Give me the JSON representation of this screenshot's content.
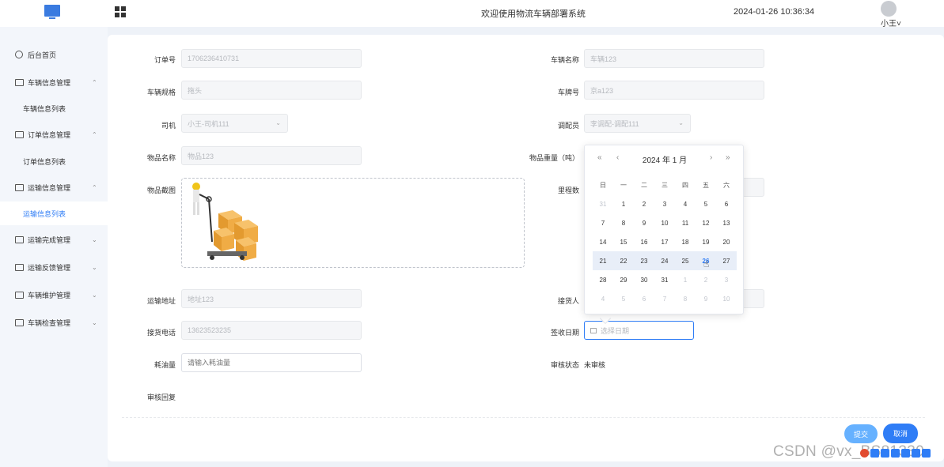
{
  "topbar": {
    "welcome": "欢迎使用物流车辆部署系统",
    "datetime": "2024-01-26 10:36:34",
    "user": "小王"
  },
  "sidebar": {
    "items": [
      {
        "label": "后台首页",
        "icon": "clock-icon"
      },
      {
        "label": "车辆信息管理",
        "icon": "list-icon",
        "caret": "⌃"
      },
      {
        "label": "车辆信息列表",
        "sub": true
      },
      {
        "label": "订单信息管理",
        "icon": "list-icon",
        "caret": "⌃"
      },
      {
        "label": "订单信息列表",
        "sub": true
      },
      {
        "label": "运输信息管理",
        "icon": "list-icon",
        "caret": "⌃"
      },
      {
        "label": "运输信息列表",
        "sub": true,
        "active": true
      },
      {
        "label": "运输完成管理",
        "icon": "list-icon",
        "caret": "⌄"
      },
      {
        "label": "运输反馈管理",
        "icon": "list-icon",
        "caret": "⌄"
      },
      {
        "label": "车辆维护管理",
        "icon": "list-icon",
        "caret": "⌄"
      },
      {
        "label": "车辆检查管理",
        "icon": "list-icon",
        "caret": "⌄"
      }
    ]
  },
  "form": {
    "order_no": {
      "label": "订单号",
      "value": "1706236410731"
    },
    "vehicle_name": {
      "label": "车辆名称",
      "value": "车辆123"
    },
    "vehicle_spec": {
      "label": "车辆规格",
      "value": "拖头"
    },
    "plate_no": {
      "label": "车牌号",
      "value": "京a123"
    },
    "driver": {
      "label": "司机",
      "value": "小王-司机111"
    },
    "dispatcher": {
      "label": "调配员",
      "value": "李调配-调配111"
    },
    "goods_name": {
      "label": "物品名称",
      "value": "物品123"
    },
    "goods_weight": {
      "label": "物品重量（吨）"
    },
    "goods_image": {
      "label": "物品截图"
    },
    "mileage": {
      "label": "里程数"
    },
    "address": {
      "label": "运输地址",
      "value": "地址123"
    },
    "receiver": {
      "label": "接货人"
    },
    "receiver_phone": {
      "label": "接货电话",
      "value": "13623523235"
    },
    "sign_date": {
      "label": "签收日期",
      "placeholder": "选择日期"
    },
    "fuel": {
      "label": "耗油量",
      "placeholder": "请输入耗油量"
    },
    "audit_status": {
      "label": "审核状态",
      "value": "未审核"
    },
    "audit_reply": {
      "label": "审核回复"
    }
  },
  "buttons": {
    "submit": "提交",
    "cancel": "取消"
  },
  "datepicker": {
    "prev_year": "«",
    "prev_month": "‹",
    "next_month": "›",
    "next_year": "»",
    "title": "2024 年  1 月",
    "weekdays": [
      "日",
      "一",
      "二",
      "三",
      "四",
      "五",
      "六"
    ],
    "weeks": [
      [
        "31",
        "1",
        "2",
        "3",
        "4",
        "5",
        "6"
      ],
      [
        "7",
        "8",
        "9",
        "10",
        "11",
        "12",
        "13"
      ],
      [
        "14",
        "15",
        "16",
        "17",
        "18",
        "19",
        "20"
      ],
      [
        "21",
        "22",
        "23",
        "24",
        "25",
        "26",
        "27"
      ],
      [
        "28",
        "29",
        "30",
        "31",
        "1",
        "2",
        "3"
      ],
      [
        "4",
        "5",
        "6",
        "7",
        "8",
        "9",
        "10"
      ]
    ]
  },
  "watermark": "CSDN @vx_BS81330",
  "colors": {
    "accent": "#2f7df6",
    "submit": "#66b1ff",
    "active_menu": "#2f7df6"
  }
}
